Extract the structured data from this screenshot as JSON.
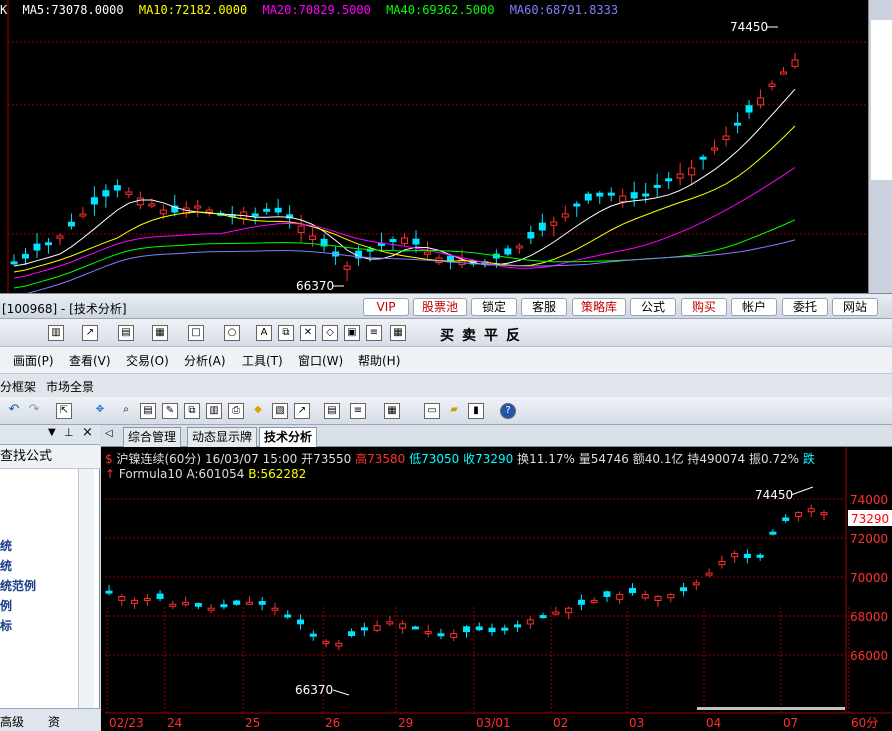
{
  "top_chart": {
    "corner": "K",
    "ma": [
      {
        "label": "MA5:73078.0000",
        "color": "#ffffff"
      },
      {
        "label": "MA10:72182.0000",
        "color": "#ffff00"
      },
      {
        "label": "MA20:70829.5000",
        "color": "#ff00ff"
      },
      {
        "label": "MA40:69362.5000",
        "color": "#00ff00"
      },
      {
        "label": "MA60:68791.8333",
        "color": "#8080ff"
      }
    ],
    "high_label": "74450",
    "low_label": "66370"
  },
  "window": {
    "title": "[100968] - [技术分析]",
    "buttons": [
      {
        "label": "VIP",
        "red": true
      },
      {
        "label": "股票池",
        "red": true
      },
      {
        "label": "锁定",
        "red": false
      },
      {
        "label": "客服",
        "red": false
      },
      {
        "label": "策略库",
        "red": true
      },
      {
        "label": "公式",
        "red": false
      },
      {
        "label": "购买",
        "red": true
      },
      {
        "label": "帐户",
        "red": false
      },
      {
        "label": "委托",
        "red": false
      },
      {
        "label": "网站",
        "red": false
      }
    ],
    "trade_chars": [
      "买",
      "卖",
      "平",
      "反"
    ]
  },
  "menu": [
    "画面(P)",
    "查看(V)",
    "交易(O)",
    "分析(A)",
    "工具(T)",
    "窗口(W)",
    "帮助(H)"
  ],
  "panel_tabs": [
    "分框架",
    "市场全景"
  ],
  "left_panel": {
    "title": "查找公式",
    "links": [
      "统",
      "统",
      "统范例",
      "例",
      "标"
    ],
    "bottom": [
      "高级",
      "资"
    ]
  },
  "tabs": [
    {
      "label": "综合管理",
      "active": false
    },
    {
      "label": "动态显示牌",
      "active": false
    },
    {
      "label": "技术分析",
      "active": true
    }
  ],
  "bottom_chart": {
    "info": {
      "symbol": "沪镍连续",
      "period": "(60分)",
      "datetime": "16/03/07 15:00",
      "open": "开73550",
      "high": "高73580",
      "low": "低73050",
      "close": "收73290",
      "turnover": "换11.17%",
      "volume": "量54746",
      "amount": "额40.1亿",
      "position": "持490074",
      "amplitude": "振0.72%",
      "change": "跌"
    },
    "formula": {
      "name": "Formula10",
      "a": "A:601054",
      "b": "B:562282"
    },
    "y_ticks": [
      "74000",
      "72000",
      "70000",
      "68000",
      "66000"
    ],
    "price_tag": "73290",
    "x_ticks": [
      "02/23",
      "24",
      "25",
      "26",
      "29",
      "03/01",
      "02",
      "03",
      "04",
      "07",
      "60分"
    ],
    "high_label": "74450",
    "low_label": "66370"
  }
}
